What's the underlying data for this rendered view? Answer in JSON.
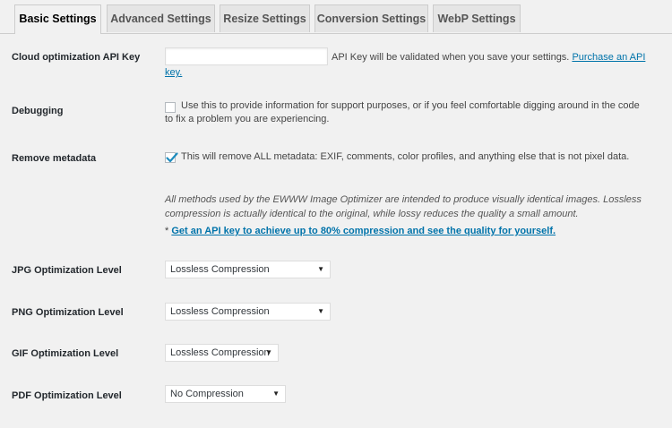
{
  "tabs": [
    {
      "label": "Basic Settings",
      "active": true
    },
    {
      "label": "Advanced Settings",
      "active": false
    },
    {
      "label": "Resize Settings",
      "active": false
    },
    {
      "label": "Conversion Settings",
      "active": false
    },
    {
      "label": "WebP Settings",
      "active": false
    }
  ],
  "api_key": {
    "label": "Cloud optimization API Key",
    "value": "",
    "note": "API Key will be validated when you save your settings.",
    "link_part1": "Purchase an API",
    "link_part2": "key."
  },
  "debugging": {
    "label": "Debugging",
    "checked": false,
    "text_line1": "Use this to provide information for support purposes, or if you feel comfortable digging around in the code",
    "text_line2": "to fix a problem you are experiencing."
  },
  "remove_metadata": {
    "label": "Remove metadata",
    "checked": true,
    "text": "This will remove ALL metadata: EXIF, comments, color profiles, and anything else that is not pixel data."
  },
  "info": {
    "line1": "All methods used by the EWWW Image Optimizer are intended to produce visually identical images. Lossless",
    "line2": "compression is actually identical to the original, while lossy reduces the quality a small amount.",
    "asterisk": "*",
    "link": "Get an API key to achieve up to 80% compression and see the quality for yourself."
  },
  "levels": [
    {
      "label": "JPG Optimization Level",
      "selected": "Lossless Compression"
    },
    {
      "label": "PNG Optimization Level",
      "selected": "Lossless Compression"
    },
    {
      "label": "GIF Optimization Level",
      "selected": "Lossless Compression"
    },
    {
      "label": "PDF Optimization Level",
      "selected": "No Compression"
    }
  ],
  "icons": {
    "select_caret": "▼",
    "checkmark": "checkmark-icon"
  },
  "colors": {
    "link": "#0073aa",
    "check": "#1e8cbe"
  }
}
